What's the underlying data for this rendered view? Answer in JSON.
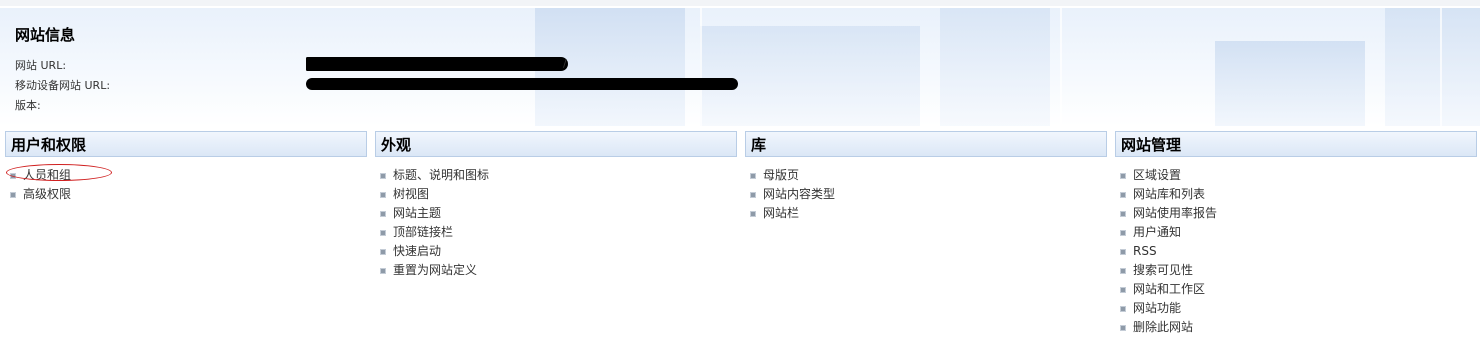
{
  "site_info": {
    "title": "网站信息",
    "url_label": "网站 URL:",
    "url_value_visible": "/",
    "mobile_url_label": "移动设备网站 URL:",
    "version_label": "版本:"
  },
  "sections": [
    {
      "title": "用户和权限",
      "items": [
        "人员和组",
        "高级权限"
      ]
    },
    {
      "title": "外观",
      "items": [
        "标题、说明和图标",
        "树视图",
        "网站主题",
        "顶部链接栏",
        "快速启动",
        "重置为网站定义"
      ]
    },
    {
      "title": "库",
      "items": [
        "母版页",
        "网站内容类型",
        "网站栏"
      ]
    },
    {
      "title": "网站管理",
      "items": [
        "区域设置",
        "网站库和列表",
        "网站使用率报告",
        "用户通知",
        "RSS",
        "搜索可见性",
        "网站和工作区",
        "网站功能",
        "删除此网站"
      ]
    }
  ],
  "colors": {
    "header_border": "#b9cde6",
    "annotation_circle": "#d02020"
  }
}
